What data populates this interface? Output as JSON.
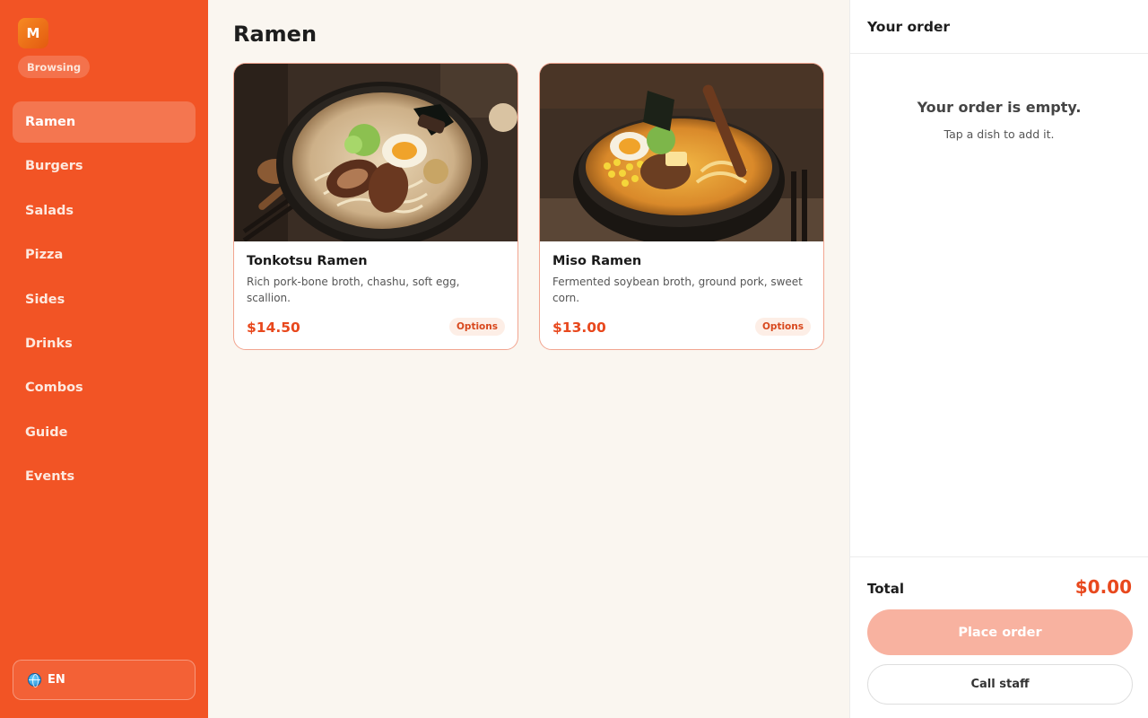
{
  "sidebar": {
    "logo_letter": "M",
    "status": "Browsing",
    "items": [
      {
        "label": "Ramen",
        "active": true
      },
      {
        "label": "Burgers"
      },
      {
        "label": "Salads"
      },
      {
        "label": "Pizza"
      },
      {
        "label": "Sides"
      },
      {
        "label": "Drinks"
      },
      {
        "label": "Combos"
      },
      {
        "label": "Guide"
      },
      {
        "label": "Events"
      }
    ],
    "language": "EN"
  },
  "main": {
    "title": "Ramen",
    "dishes": [
      {
        "name": "Tonkotsu Ramen",
        "description": "Rich pork-bone broth, chashu, soft egg, scallion.",
        "price": "$14.50",
        "options_label": "Options"
      },
      {
        "name": "Miso Ramen",
        "description": "Fermented soybean broth, ground pork, sweet corn.",
        "price": "$13.00",
        "options_label": "Options"
      }
    ]
  },
  "order": {
    "header": "Your order",
    "empty_title": "Your order is empty.",
    "empty_subtitle": "Tap a dish to add it.",
    "total_label": "Total",
    "total_value": "$0.00",
    "place_order_label": "Place order",
    "call_staff_label": "Call staff"
  },
  "colors": {
    "brand": "#f25425",
    "price": "#e8481d",
    "place_order_disabled": "#f8b2a0"
  }
}
